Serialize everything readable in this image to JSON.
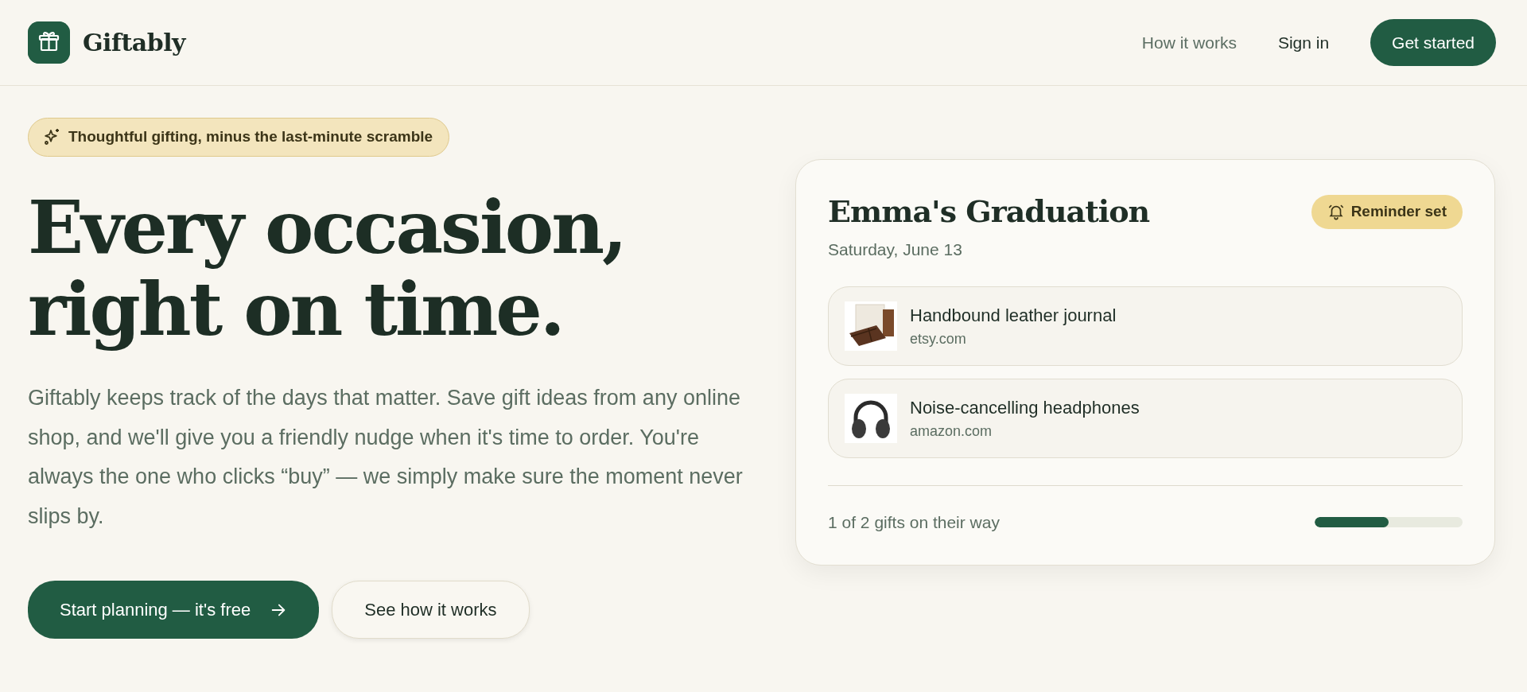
{
  "brand": {
    "name": "Giftably"
  },
  "nav": {
    "links": [
      {
        "label": "How it works",
        "kind": "muted"
      },
      {
        "label": "Sign in",
        "kind": "plain"
      }
    ],
    "cta": "Get started"
  },
  "hero": {
    "badge": "Thoughtful gifting, minus the last-minute scramble",
    "headline": [
      "Every occasion,",
      "right on time."
    ],
    "body": "Giftably keeps track of the days that matter. Save gift ideas from any online shop, and we'll give you a friendly nudge when it's time to order. You're always the one who clicks “buy” — we simply make sure the moment never slips by.",
    "buttons": [
      {
        "label": "Start planning — it's free",
        "kind": "primary"
      },
      {
        "label": "See how it works",
        "kind": "secondary"
      }
    ]
  },
  "event_card": {
    "title": "Emma's Graduation",
    "date": "Saturday, June 13",
    "reminder": {
      "label": "Reminder set",
      "on": true
    },
    "gifts": [
      {
        "name": "Handbound leather journal",
        "shop": "etsy.com",
        "kind": "journal"
      },
      {
        "name": "Noise-cancelling headphones",
        "shop": "amazon.com",
        "kind": "headphones"
      }
    ],
    "progress": {
      "text": "1 of 2 gifts on their way",
      "level": 0.5
    }
  }
}
